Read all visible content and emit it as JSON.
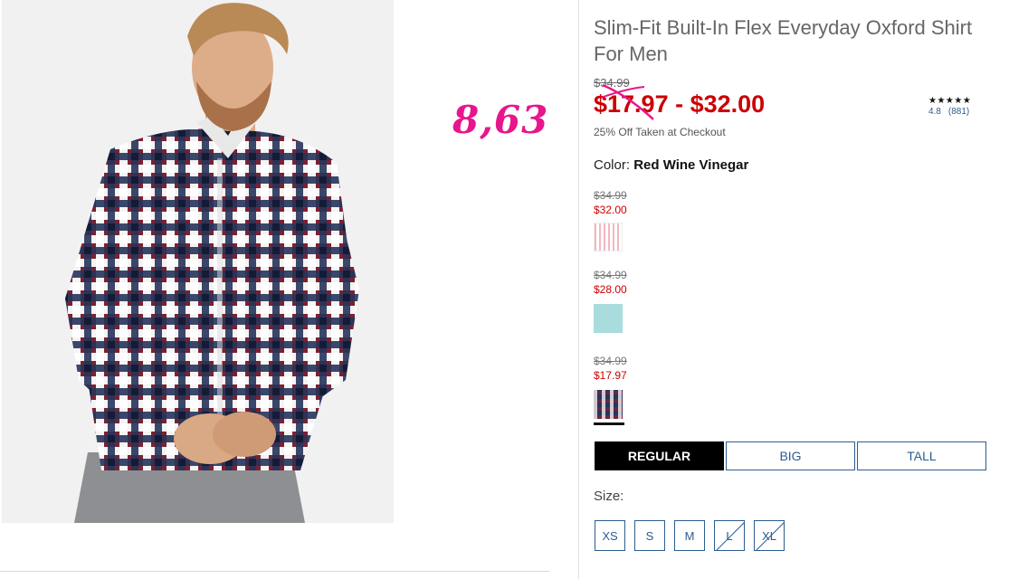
{
  "product": {
    "title": "Slim-Fit Built-In Flex Everyday Oxford Shirt For Men",
    "original_price": "$34.99",
    "price_range": "$17.97 - $32.00",
    "promo": "25% Off Taken at Checkout",
    "rating": {
      "stars": "★★★★★",
      "score": "4.8",
      "count": "(881)",
      "value": 4.8
    }
  },
  "annotation": {
    "text": "8,63",
    "color": "#e8168c"
  },
  "color": {
    "label": "Color:",
    "selected": "Red Wine Vinegar"
  },
  "swatches": [
    {
      "original": "$34.99",
      "sale": "$32.00",
      "name": "pink-stripe"
    },
    {
      "original": "$34.99",
      "sale": "$28.00",
      "name": "aqua"
    },
    {
      "original": "$34.99",
      "sale": "$17.97",
      "name": "red-navy-plaid",
      "selected": true
    }
  ],
  "fits": [
    {
      "label": "REGULAR",
      "active": true
    },
    {
      "label": "BIG",
      "active": false
    },
    {
      "label": "TALL",
      "active": false
    }
  ],
  "size_label": "Size:",
  "sizes": [
    {
      "label": "XS",
      "available": true
    },
    {
      "label": "S",
      "available": true
    },
    {
      "label": "M",
      "available": true
    },
    {
      "label": "L",
      "available": false
    },
    {
      "label": "XL",
      "available": false
    }
  ],
  "colors": {
    "sale": "#cc0000",
    "link": "#2c5d8f",
    "active_fit": "#000000"
  }
}
